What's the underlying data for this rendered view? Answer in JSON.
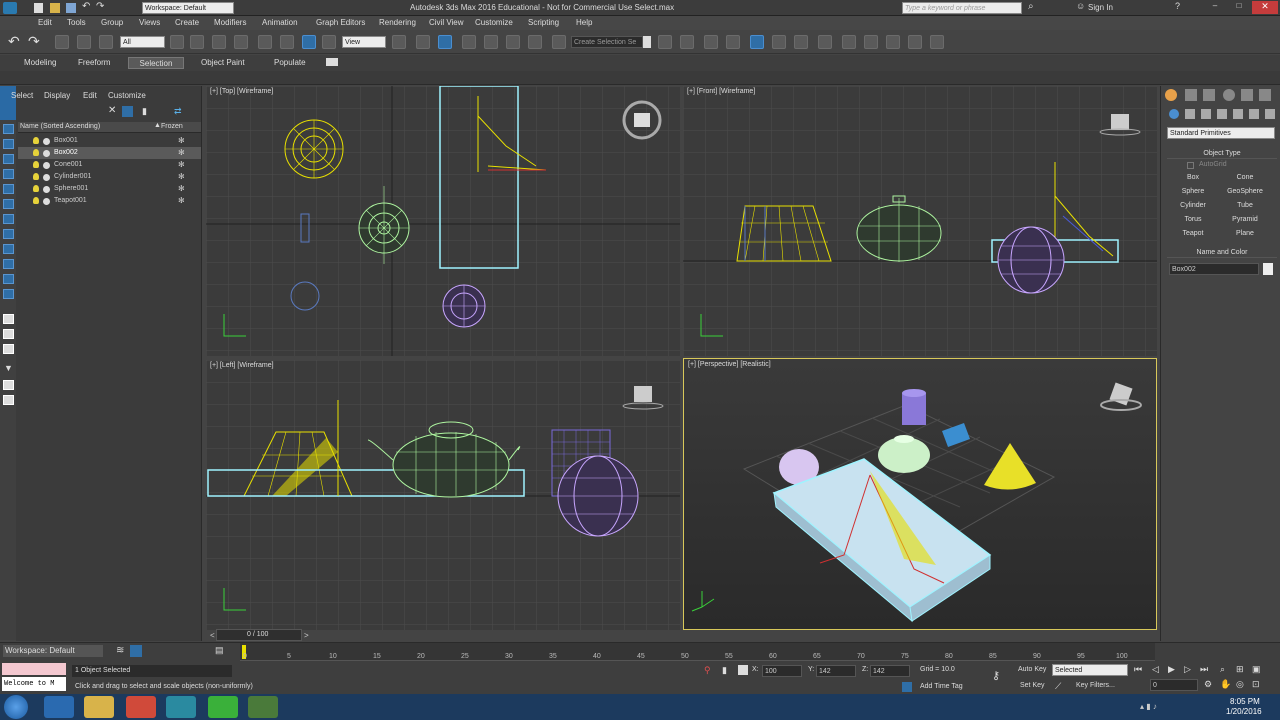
{
  "titlebar": {
    "workspace": "Workspace: Default",
    "title": "Autodesk 3ds Max 2016 Educational - Not for Commercial Use   Select.max",
    "search_placeholder": "Type a keyword or phrase",
    "sign_in": "Sign In"
  },
  "menu": [
    "Edit",
    "Tools",
    "Group",
    "Views",
    "Create",
    "Modifiers",
    "Animation",
    "Graph Editors",
    "Rendering",
    "Civil View",
    "Customize",
    "Scripting",
    "Help"
  ],
  "toolbar": {
    "filter_value": "All",
    "view_value": "View",
    "selection_set_placeholder": "Create Selection Se"
  },
  "ribbon": {
    "tabs": [
      "Modeling",
      "Freeform",
      "Selection",
      "Object Paint",
      "Populate"
    ]
  },
  "explorer": {
    "menu": [
      "Select",
      "Display",
      "Edit",
      "Customize"
    ],
    "col_name": "Name (Sorted Ascending)",
    "col_frozen": "Frozen",
    "rows": [
      "Box001",
      "Box002",
      "Cone001",
      "Cylinder001",
      "Sphere001",
      "Teapot001"
    ]
  },
  "viewports": {
    "top": "[+] [Top] [Wireframe]",
    "front": "[+] [Front] [Wireframe]",
    "left": "[+] [Left] [Wireframe]",
    "persp": "[+] [Perspective] [Realistic]"
  },
  "command_panel": {
    "dropdown": "Standard Primitives",
    "object_type": "Object Type",
    "autogrid": "AutoGrid",
    "buttons": [
      "Box",
      "Cone",
      "Sphere",
      "GeoSphere",
      "Cylinder",
      "Tube",
      "Torus",
      "Pyramid",
      "Teapot",
      "Plane"
    ],
    "name_color": "Name and Color",
    "name_value": "Box002"
  },
  "bottom": {
    "workspace": "Workspace: Default",
    "frame": "0 / 100",
    "ticks": [
      "0",
      "5",
      "10",
      "15",
      "20",
      "25",
      "30",
      "35",
      "40",
      "45",
      "50",
      "55",
      "60",
      "65",
      "70",
      "75",
      "80",
      "85",
      "90",
      "95",
      "100"
    ],
    "maxscript": "Welcome to M",
    "status": "1 Object Selected",
    "prompt": "Click and drag to select and scale objects (non-uniformly)",
    "x_label": "X:",
    "x": "100",
    "y_label": "Y:",
    "y": "142",
    "z_label": "Z:",
    "z": "142",
    "grid": "Grid = 10.0",
    "add_time_tag": "Add Time Tag",
    "auto_key": "Auto Key",
    "auto_key_value": "Selected",
    "set_key": "Set Key",
    "key_filters": "Key Filters...",
    "frame_field": "0"
  },
  "taskbar": {
    "time": "8:05 PM",
    "date": "1/20/2016"
  },
  "colors": {
    "accent": "#2f6ea6",
    "wire_yellow": "#e8e000",
    "wire_green": "#aef5a0",
    "wire_purple": "#c8a6ff",
    "select_cyan": "#9ff3ff"
  }
}
